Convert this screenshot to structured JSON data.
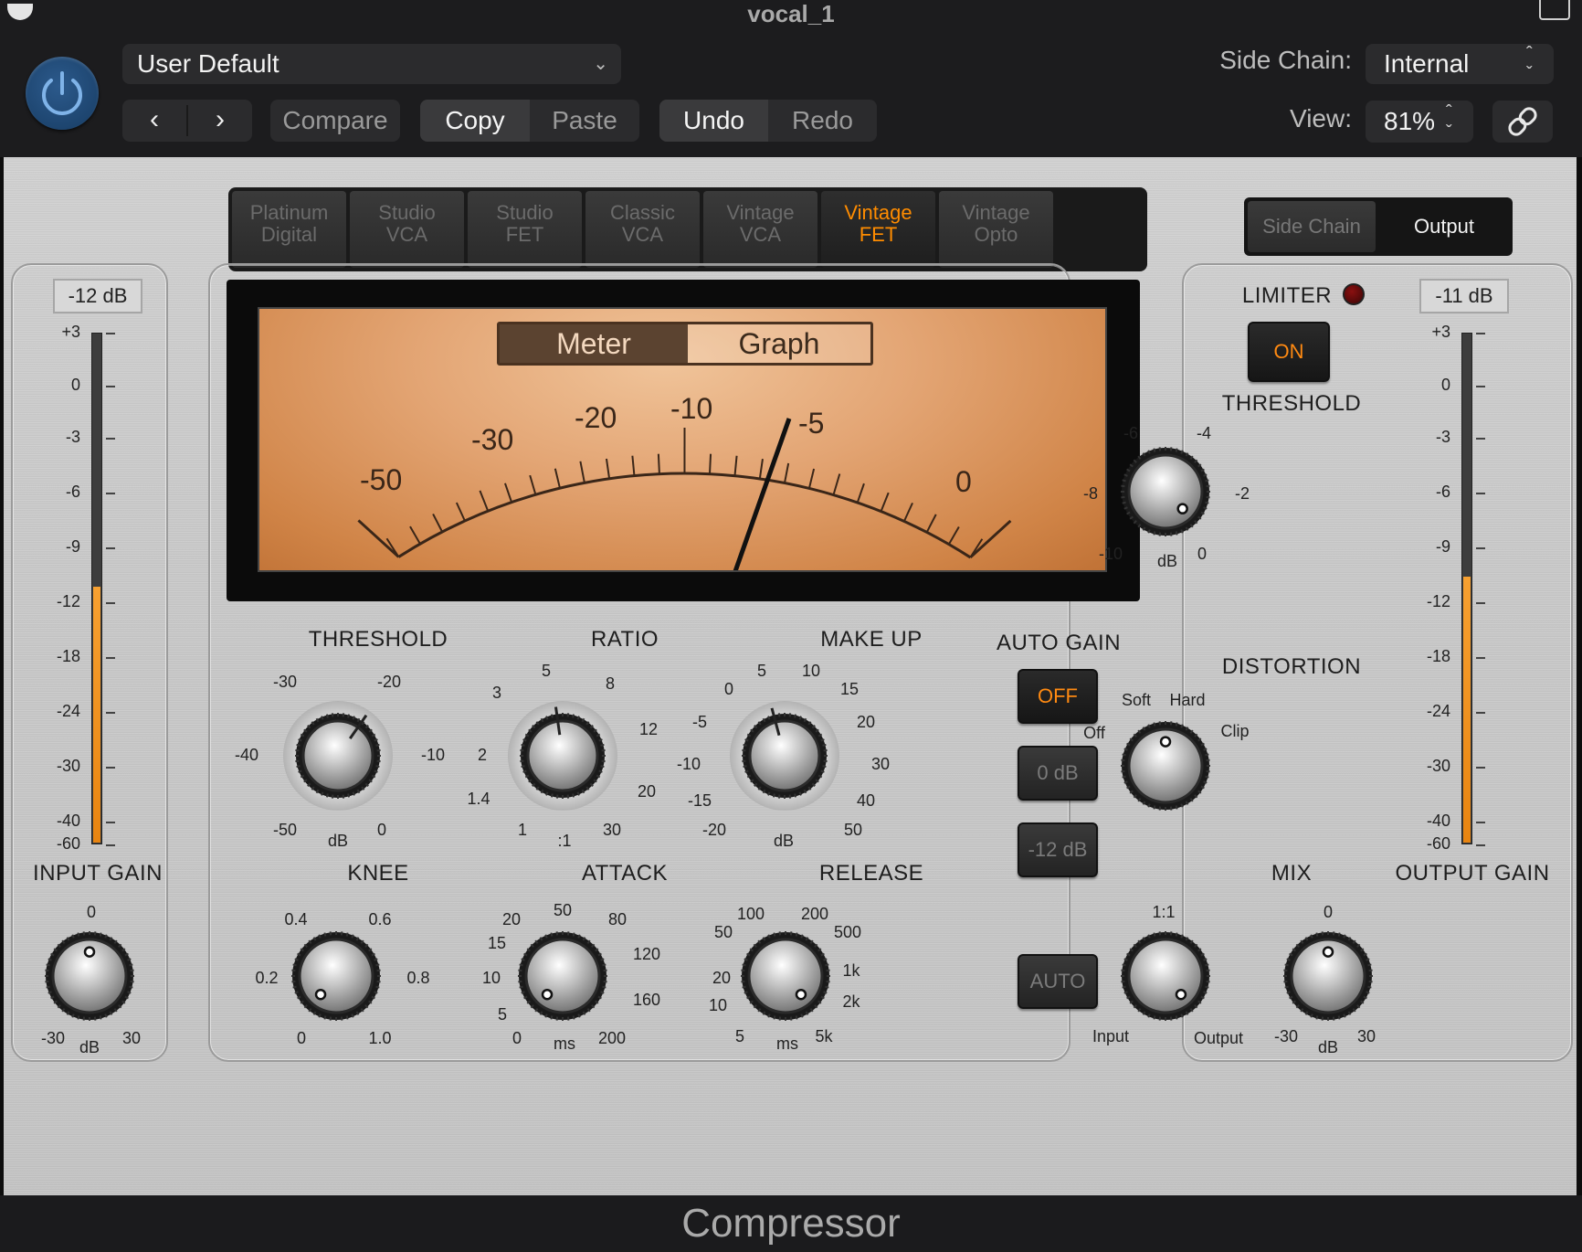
{
  "window": {
    "title": "vocal_1",
    "footer": "Compressor"
  },
  "header": {
    "preset": "User Default",
    "compare": "Compare",
    "copy": "Copy",
    "paste": "Paste",
    "undo": "Undo",
    "redo": "Redo",
    "side_chain_label": "Side Chain:",
    "side_chain_value": "Internal",
    "view_label": "View:",
    "view_value": "81%"
  },
  "models": [
    {
      "line1": "Platinum",
      "line2": "Digital"
    },
    {
      "line1": "Studio",
      "line2": "VCA"
    },
    {
      "line1": "Studio",
      "line2": "FET"
    },
    {
      "line1": "Classic",
      "line2": "VCA"
    },
    {
      "line1": "Vintage",
      "line2": "VCA"
    },
    {
      "line1": "Vintage",
      "line2": "FET"
    },
    {
      "line1": "Vintage",
      "line2": "Opto"
    }
  ],
  "active_model": "Vintage FET",
  "right_tabs": {
    "side_chain": "Side Chain",
    "output": "Output"
  },
  "input": {
    "readout": "-12 dB",
    "label": "INPUT GAIN",
    "knob_min": "-30",
    "knob_max": "30",
    "knob_top": "0",
    "unit": "dB",
    "meter_level": 0.5
  },
  "output": {
    "readout": "-11 dB",
    "label": "OUTPUT GAIN",
    "knob_min": "-30",
    "knob_max": "30",
    "knob_top": "0",
    "unit": "dB",
    "meter_level": 0.52
  },
  "meter_scale": [
    "+3",
    "0",
    "-3",
    "-6",
    "-9",
    "-12",
    "-18",
    "-24",
    "-30",
    "-40",
    "-60"
  ],
  "vu": {
    "tab_meter": "Meter",
    "tab_graph": "Graph",
    "scale": [
      "-50",
      "-30",
      "-20",
      "-10",
      "-5",
      "0"
    ]
  },
  "controls": {
    "threshold": {
      "label": "THRESHOLD",
      "ticks": [
        "-30",
        "-20",
        "-40",
        "-10",
        "-50",
        "0"
      ],
      "unit": "dB"
    },
    "ratio": {
      "label": "RATIO",
      "ticks": [
        "5",
        "8",
        "3",
        "12",
        "2",
        "20",
        "1.4",
        "1",
        "30"
      ],
      "unit": ":1"
    },
    "makeup": {
      "label": "MAKE UP",
      "ticks": [
        "5",
        "10",
        "0",
        "15",
        "-5",
        "20",
        "-10",
        "30",
        "-15",
        "40",
        "-20",
        "50"
      ],
      "unit": "dB"
    },
    "auto_gain": {
      "label": "AUTO GAIN",
      "off": "OFF",
      "zero": "0 dB",
      "minus12": "-12 dB"
    },
    "knee": {
      "label": "KNEE",
      "ticks": [
        "0.4",
        "0.6",
        "0.2",
        "0.8",
        "0",
        "1.0"
      ]
    },
    "attack": {
      "label": "ATTACK",
      "ticks": [
        "50",
        "20",
        "80",
        "15",
        "120",
        "10",
        "160",
        "5",
        "0",
        "200"
      ],
      "unit": "ms"
    },
    "release": {
      "label": "RELEASE",
      "ticks": [
        "100",
        "200",
        "50",
        "500",
        "20",
        "1k",
        "10",
        "2k",
        "5",
        "5k"
      ],
      "unit": "ms"
    },
    "auto": "AUTO",
    "limiter": {
      "label": "LIMITER",
      "on": "ON",
      "threshold_label": "THRESHOLD",
      "ticks": [
        "-6",
        "-4",
        "-8",
        "-2",
        "-10",
        "0"
      ],
      "unit": "dB"
    },
    "distortion": {
      "label": "DISTORTION",
      "ticks": [
        "Soft",
        "Hard",
        "Off",
        "Clip"
      ]
    },
    "mix": {
      "label": "MIX",
      "top": "1:1",
      "left": "Input",
      "right": "Output"
    }
  }
}
